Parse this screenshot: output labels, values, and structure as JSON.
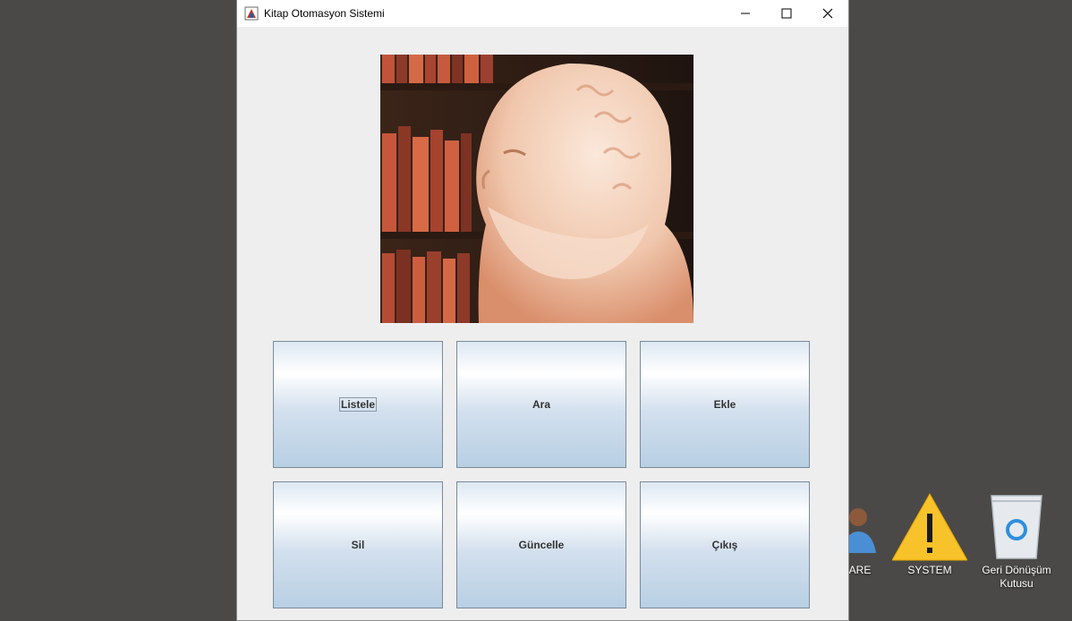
{
  "window": {
    "title": "Kitap Otomasyon Sistemi",
    "controls": {
      "minimize": "minimize-icon",
      "maximize": "maximize-icon",
      "close": "close-icon"
    }
  },
  "image": {
    "subject": "socrates-bust-library-photo"
  },
  "buttons": [
    {
      "label": "Listele",
      "focused": true
    },
    {
      "label": "Ara"
    },
    {
      "label": "Ekle"
    },
    {
      "label": "Sil"
    },
    {
      "label": "Güncelle"
    },
    {
      "label": "Çıkış"
    }
  ],
  "desktop": {
    "icons": [
      {
        "label": "ARE",
        "icon": "user-icon"
      },
      {
        "label": "SYSTEM",
        "icon": "warning-icon"
      },
      {
        "label": "Geri Dönüşüm Kutusu",
        "icon": "recycle-bin-icon"
      }
    ]
  },
  "colors": {
    "desktop": "#4b4947",
    "window_bg": "#eeeeee",
    "button_gradient_bottom": "#b8cfe4"
  }
}
